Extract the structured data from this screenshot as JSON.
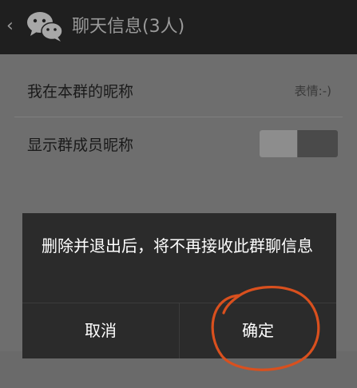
{
  "header": {
    "title": "聊天信息(3人)",
    "back_icon": "chevron-left-icon",
    "logo_icon": "wechat-logo-icon"
  },
  "settings": {
    "rows": [
      {
        "label": "我在本群的昵称",
        "value": "表情:-)"
      },
      {
        "label": "显示群成员昵称",
        "toggle_on": false
      }
    ]
  },
  "dialog": {
    "message": "删除并退出后，将不再接收此群聊信息",
    "cancel_label": "取消",
    "confirm_label": "确定"
  },
  "annotation": {
    "type": "red-circle-highlight",
    "target": "confirm_button",
    "color": "#d9501e"
  }
}
